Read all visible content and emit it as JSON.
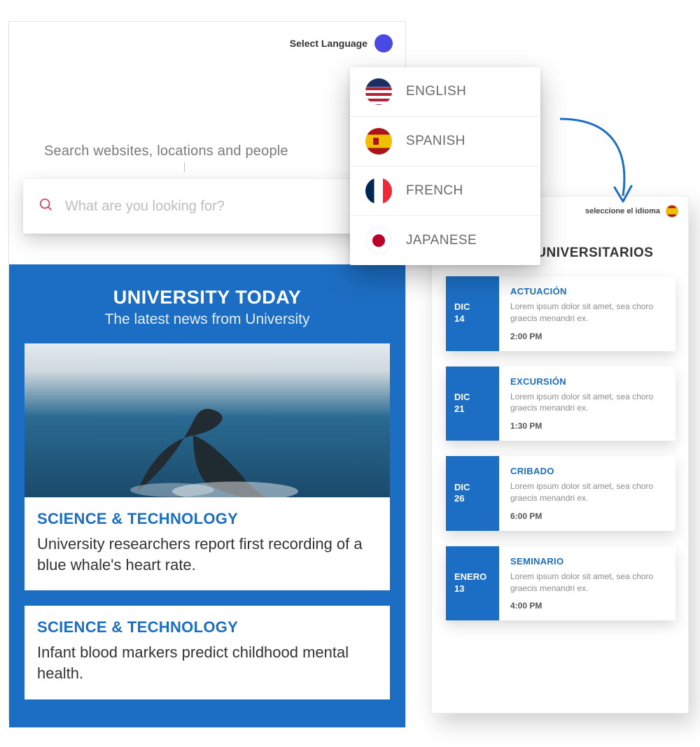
{
  "header": {
    "select_language_label": "Select Language"
  },
  "search": {
    "caption": "Search websites, locations and people",
    "placeholder": "What are you looking for?"
  },
  "news": {
    "title": "UNIVERSITY TODAY",
    "subtitle": "The latest news from University",
    "cards": [
      {
        "category": "SCIENCE & TECHNOLOGY",
        "headline": "University researchers report first recording of a blue whale's  heart rate."
      },
      {
        "category": "SCIENCE & TECHNOLOGY",
        "headline": "Infant blood markers predict childhood mental health."
      }
    ]
  },
  "language_menu": {
    "options": [
      {
        "label": "ENGLISH",
        "flag": "us"
      },
      {
        "label": "SPANISH",
        "flag": "es"
      },
      {
        "label": "FRENCH",
        "flag": "fr"
      },
      {
        "label": "JAPANESE",
        "flag": "jp"
      }
    ]
  },
  "right_panel": {
    "selector_label": "seleccione el idioma",
    "title": "EVENTOS UNIVERSITARIOS",
    "events": [
      {
        "month": "DIC",
        "day": "14",
        "category": "ACTUACIÓN",
        "desc": "Lorem ipsum dolor sit amet, sea choro graecis menandri ex.",
        "time": "2:00 PM"
      },
      {
        "month": "DIC",
        "day": "21",
        "category": "EXCURSIÓN",
        "desc": "Lorem ipsum dolor sit amet, sea choro graecis menandri ex.",
        "time": "1:30 PM"
      },
      {
        "month": "DIC",
        "day": "26",
        "category": "CRIBADO",
        "desc": "Lorem ipsum dolor sit amet, sea choro graecis menandri ex.",
        "time": "6:00 PM"
      },
      {
        "month": "ENERO",
        "day": "13",
        "category": "SEMINARIO",
        "desc": "Lorem ipsum dolor sit amet, sea choro graecis menandri ex.",
        "time": "4:00 PM"
      }
    ]
  },
  "colors": {
    "brand_blue": "#1c6ec4",
    "link_blue": "#1b6ec2"
  }
}
